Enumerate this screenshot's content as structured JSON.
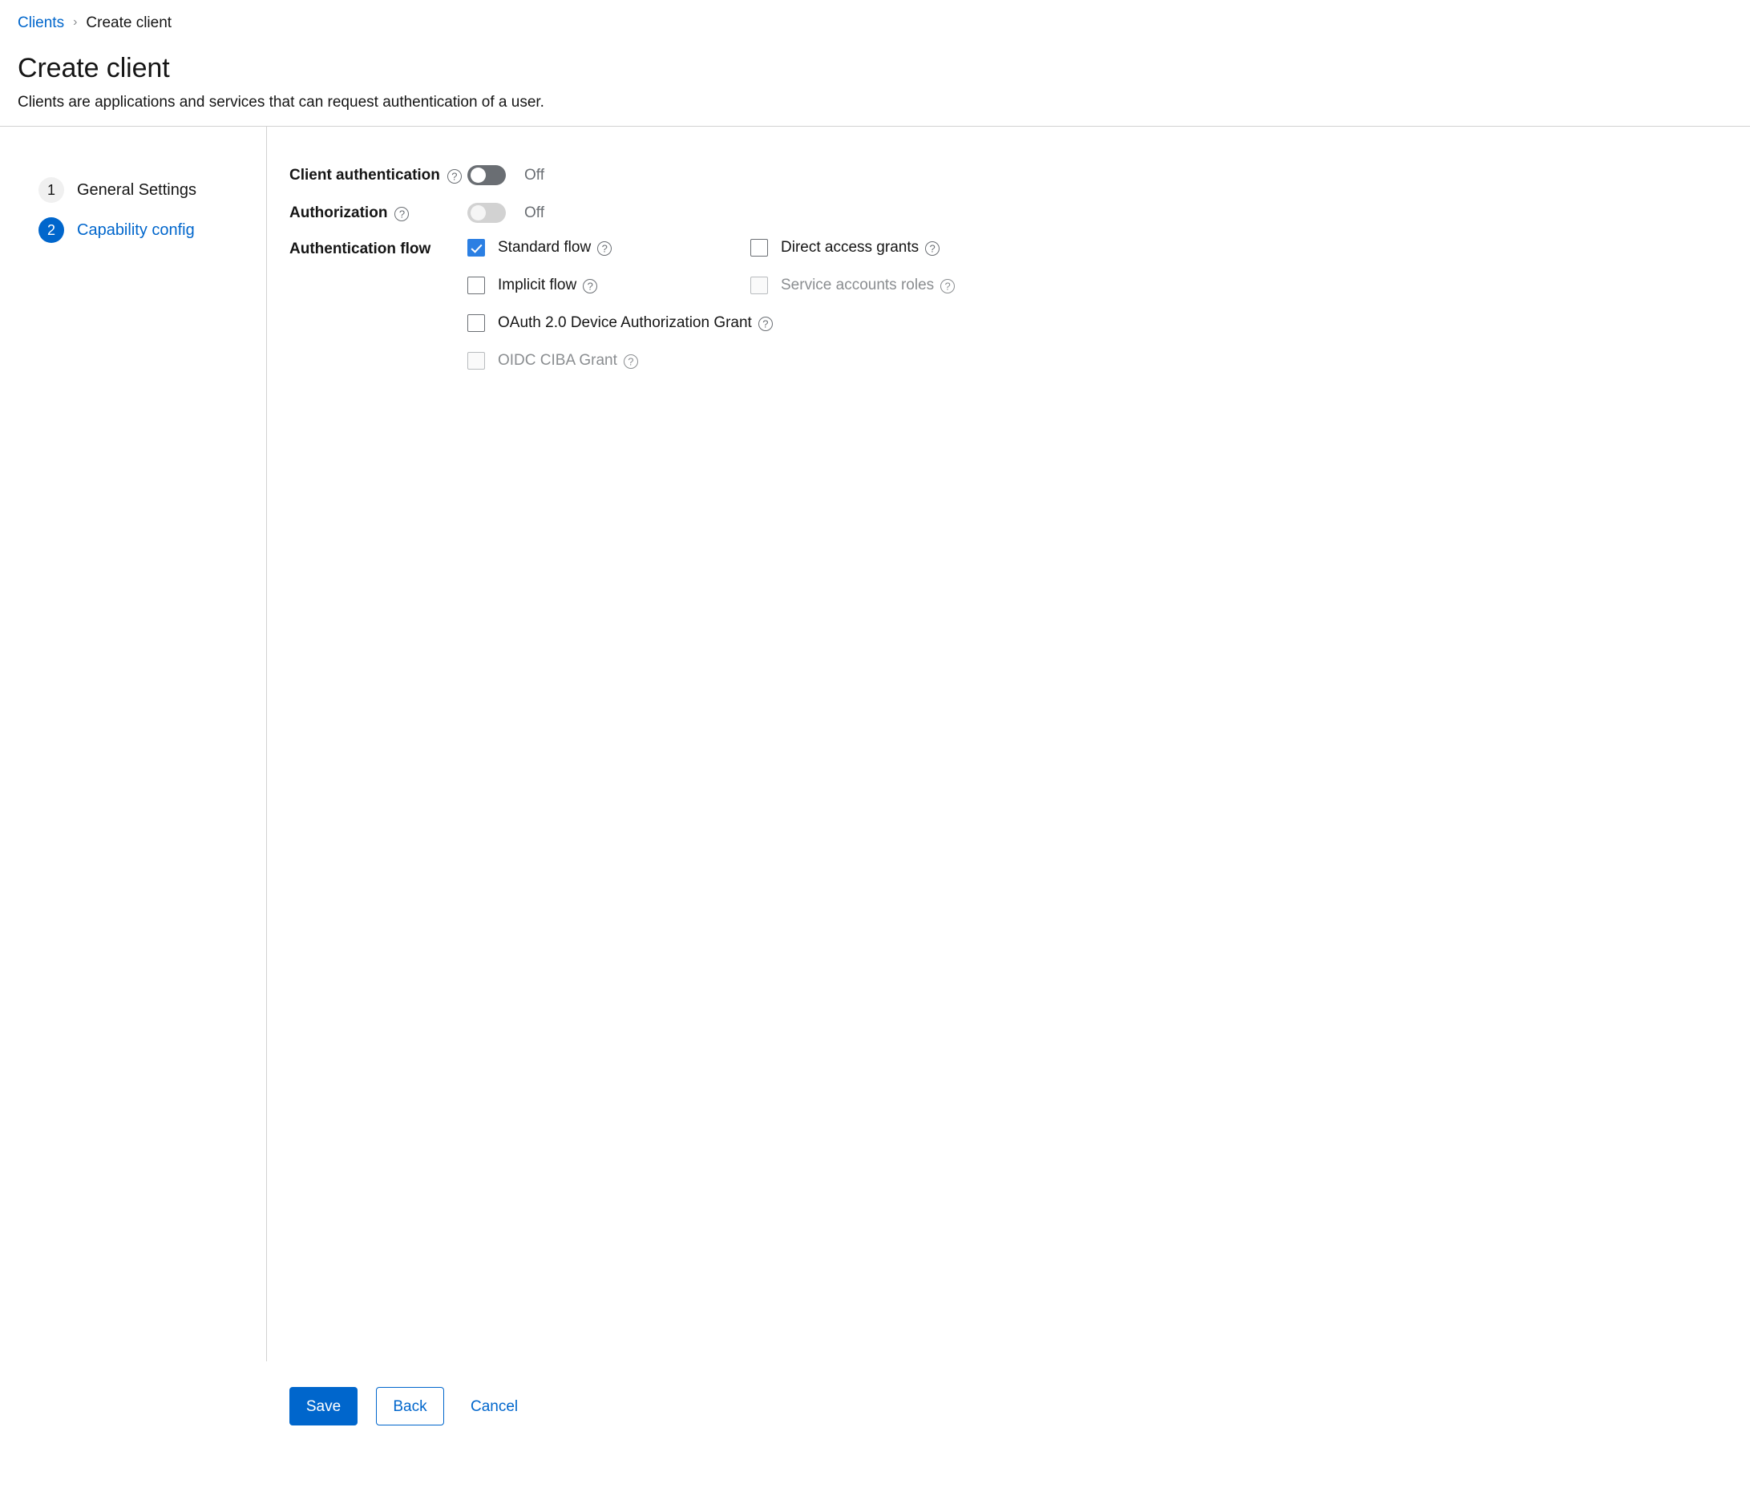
{
  "breadcrumb": {
    "parent": "Clients",
    "separator": "›",
    "current": "Create client"
  },
  "header": {
    "title": "Create client",
    "subtitle": "Clients are applications and services that can request authentication of a user."
  },
  "wizard_nav": {
    "steps": [
      {
        "number": "1",
        "label": "General Settings",
        "active": false
      },
      {
        "number": "2",
        "label": "Capability config",
        "active": true
      }
    ]
  },
  "form": {
    "client_authentication": {
      "label": "Client authentication",
      "help_icon": "help-circle-icon",
      "toggle_state": "off",
      "state_label": "Off",
      "disabled": false
    },
    "authorization": {
      "label": "Authorization",
      "help_icon": "help-circle-icon",
      "toggle_state": "off",
      "state_label": "Off",
      "disabled": true
    },
    "authentication_flow": {
      "label": "Authentication flow",
      "options": [
        {
          "label": "Standard flow",
          "checked": true,
          "disabled": false,
          "column": "left",
          "row": 1
        },
        {
          "label": "Direct access grants",
          "checked": false,
          "disabled": false,
          "column": "right",
          "row": 1
        },
        {
          "label": "Implicit flow",
          "checked": false,
          "disabled": false,
          "column": "left",
          "row": 2
        },
        {
          "label": "Service accounts roles",
          "checked": false,
          "disabled": true,
          "column": "right",
          "row": 2
        },
        {
          "label": "OAuth 2.0 Device Authorization Grant",
          "checked": false,
          "disabled": false,
          "column": "left",
          "row": 3
        },
        {
          "label": "OIDC CIBA Grant",
          "checked": false,
          "disabled": true,
          "column": "left",
          "row": 4
        }
      ]
    }
  },
  "footer": {
    "save_label": "Save",
    "back_label": "Back",
    "cancel_label": "Cancel"
  },
  "colors": {
    "accent": "#0066cc",
    "checkbox_checked": "#2b7fe3",
    "toggle_off_track": "#6a6e73",
    "toggle_disabled_track": "#d2d2d2",
    "muted_text": "#6a6e73",
    "disabled_text": "#8a8d90",
    "border": "#d2d2d2"
  }
}
